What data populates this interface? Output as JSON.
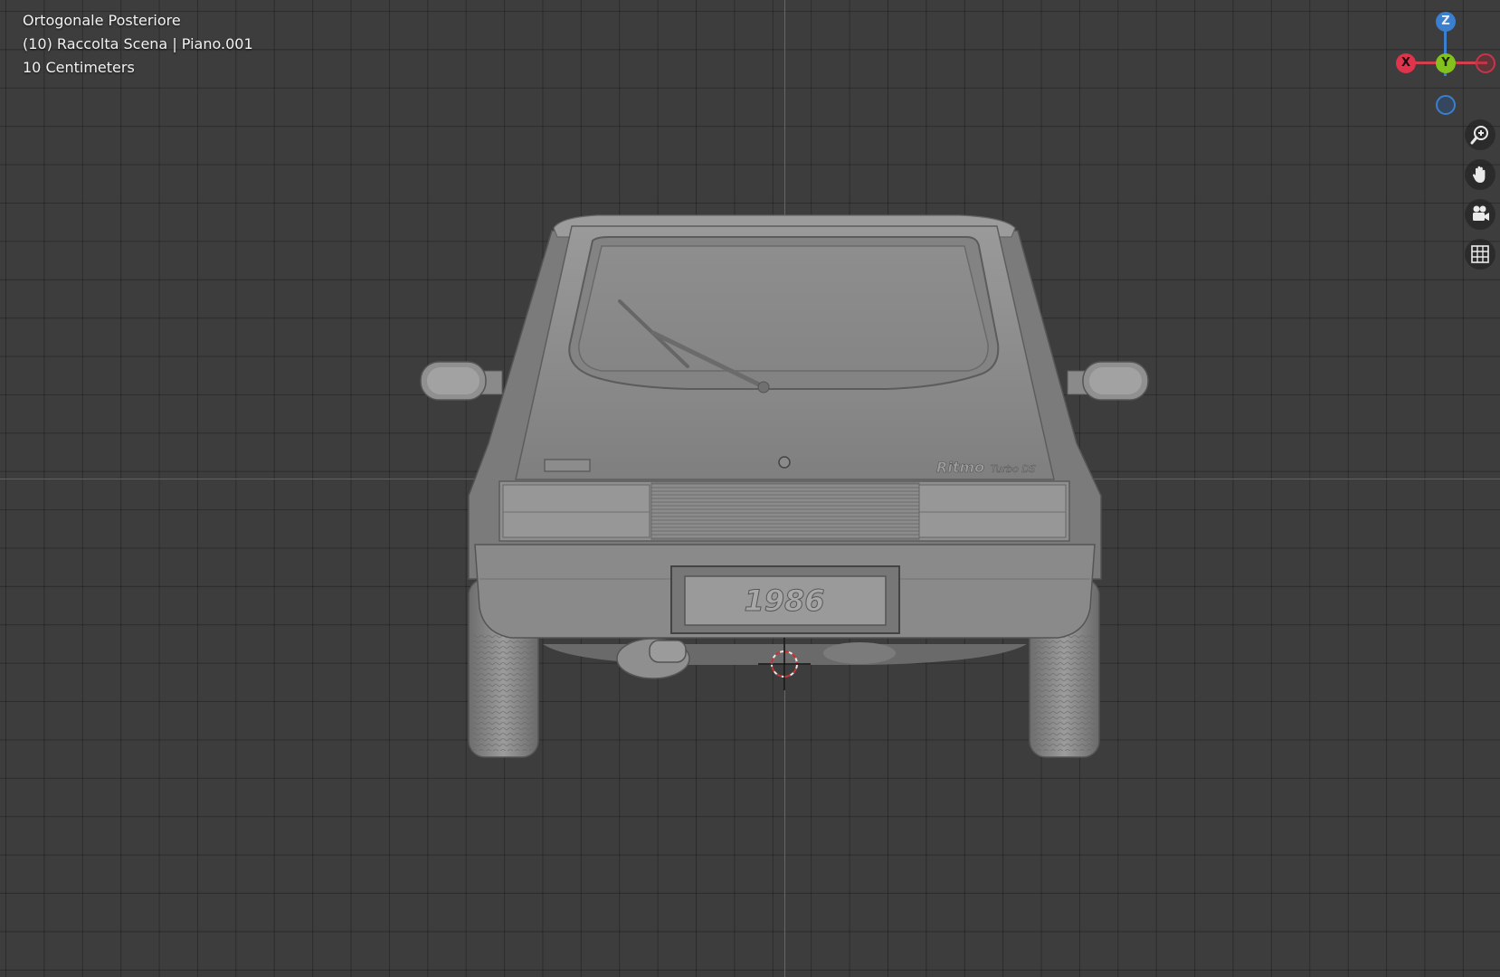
{
  "viewport": {
    "view_name": "Ortogonale Posteriore",
    "collection_info": "(10) Raccolta Scena | Piano.001",
    "grid_scale": "10 Centimeters"
  },
  "model": {
    "badge_model": "Ritmo",
    "badge_variant": "Turbo DS",
    "plate_text": "1986"
  },
  "gizmo": {
    "z_label": "Z",
    "y_label": "Y",
    "x_label": "X",
    "z_color": "#3a7fd0",
    "y_color": "#83c21c",
    "x_color": "#e0344d"
  },
  "tools": [
    {
      "name": "zoom",
      "icon": "zoom-in-icon"
    },
    {
      "name": "pan",
      "icon": "hand-icon"
    },
    {
      "name": "camera",
      "icon": "camera-icon"
    },
    {
      "name": "ortho-grid",
      "icon": "grid-icon"
    }
  ],
  "colors": {
    "background": "#3d3d3d",
    "x_axis": "#b73a49",
    "z_axis": "#3f6fa8",
    "model_gray": "#8a8a8a"
  }
}
